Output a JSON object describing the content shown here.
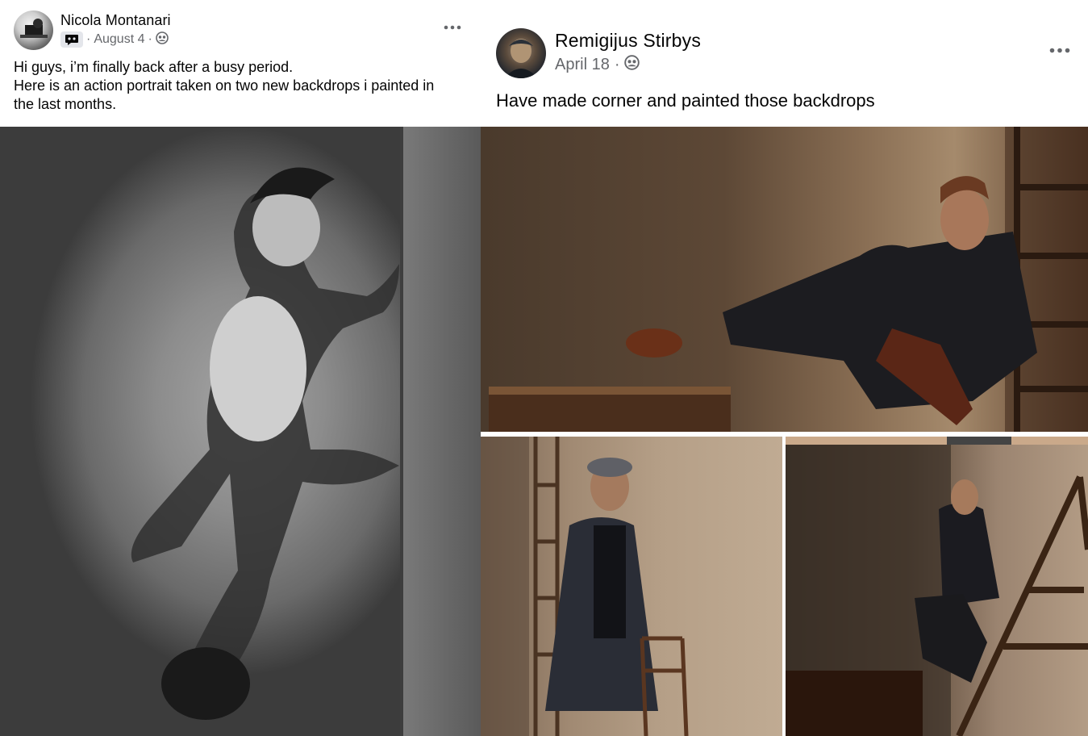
{
  "left_post": {
    "author": "Nicola Montanari",
    "date": "August 4",
    "separator": "·",
    "text_lines": [
      "Hi guys, i’m finally back after a busy period.",
      "Here is an action portrait taken on two new backdrops i painted in",
      "the last months."
    ],
    "icons": {
      "group": "group-chat-icon",
      "audience": "group-audience-icon",
      "more": "more-options-icon"
    }
  },
  "right_post": {
    "author": "Remigijus Stirbys",
    "date": "April 18",
    "separator": "·",
    "text": "Have made corner and painted those backdrops",
    "icons": {
      "audience": "group-audience-icon",
      "more": "more-options-icon"
    }
  },
  "colors": {
    "text_primary": "#050505",
    "text_secondary": "#65676b",
    "badge_bg": "#e4e6eb"
  }
}
